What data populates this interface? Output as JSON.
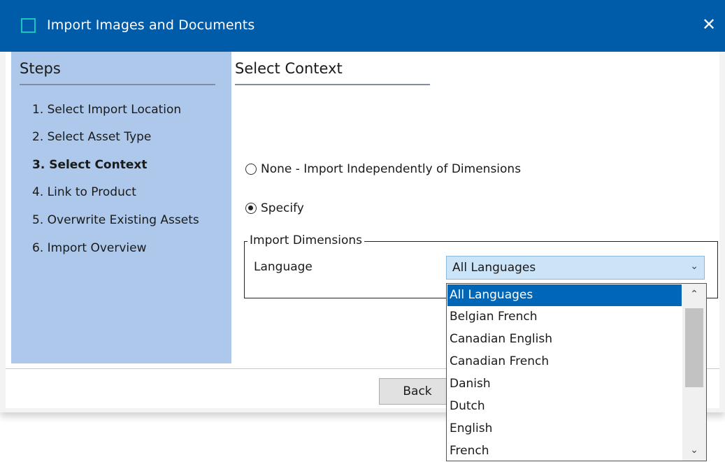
{
  "window": {
    "title": "Import Images and Documents",
    "close_glyph": "✕"
  },
  "steps": {
    "heading": "Steps",
    "items": [
      {
        "label": "1. Select Import Location"
      },
      {
        "label": "2. Select Asset Type"
      },
      {
        "label": "3. Select Context"
      },
      {
        "label": "4. Link to Product"
      },
      {
        "label": "5. Overwrite Existing Assets"
      },
      {
        "label": "6. Import Overview"
      }
    ]
  },
  "content": {
    "heading": "Select Context",
    "options": [
      {
        "label": "None - Import Independently of Dimensions",
        "checked": false
      },
      {
        "label": "Specify",
        "checked": true
      }
    ],
    "group": {
      "legend": "Import Dimensions",
      "language_label": "Language",
      "language_value": "All Languages",
      "dropdown_icon": "chevron-down-icon"
    }
  },
  "buttons": {
    "back_label": "Back"
  },
  "dropdown": {
    "items": [
      "All Languages",
      "Belgian French",
      "Canadian English",
      "Canadian French",
      "Danish",
      "Dutch",
      "English",
      "French"
    ],
    "selected_index": 0,
    "scroll_up_glyph": "⌃",
    "scroll_down_glyph": "⌄"
  },
  "colors": {
    "titlebar": "#005ba8",
    "steps_panel": "#adc8ea",
    "selection": "#0066b8",
    "select_field": "#cce4f7"
  }
}
